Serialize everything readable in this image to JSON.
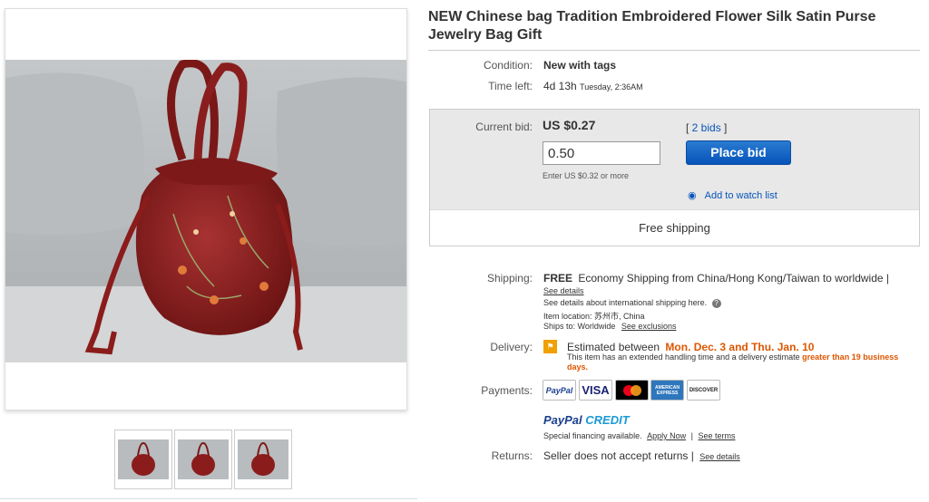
{
  "listing": {
    "title": "NEW Chinese bag Tradition Embroidered Flower Silk Satin Purse Jewelry Bag Gift"
  },
  "condition": {
    "label": "Condition:",
    "value": "New with tags"
  },
  "time_left": {
    "label": "Time left:",
    "value": "4d 13h",
    "detail": "Tuesday, 2:36AM"
  },
  "bid": {
    "label": "Current bid:",
    "price": "US $0.27",
    "bids_link": "2 bids",
    "input_value": "0.50",
    "hint": "Enter US $0.32 or more",
    "place_bid": "Place bid",
    "watch": "Add to watch list",
    "free_shipping": "Free shipping"
  },
  "shipping": {
    "label": "Shipping:",
    "free": "FREE",
    "method": "Economy Shipping from China/Hong Kong/Taiwan to worldwide |",
    "see_details": "See details",
    "intl": "See details about international shipping here.",
    "location_label": "Item location:",
    "location": "苏州市, China",
    "ships_to_label": "Ships to:",
    "ships_to": "Worldwide",
    "exclusions": "See exclusions"
  },
  "delivery": {
    "label": "Delivery:",
    "estimated": "Estimated between",
    "dates": "Mon. Dec. 3 and Thu. Jan. 10",
    "note": "This item has an extended handling time and a delivery estimate",
    "note_strong": "greater than 19 business days."
  },
  "payments": {
    "label": "Payments:",
    "logos": [
      "PayPal",
      "VISA",
      "MasterCard",
      "AMERICAN EXPRESS",
      "DISCOVER"
    ],
    "credit_brand": "PayPal",
    "credit_word": "CREDIT",
    "financing": "Special financing available.",
    "apply": "Apply Now",
    "terms": "See terms"
  },
  "returns": {
    "label": "Returns:",
    "value": "Seller does not accept returns |",
    "see_details": "See details"
  },
  "colors": {
    "accent_blue": "#0654ba",
    "delivery_orange": "#dd5600",
    "bag_red": "#8b1c1c"
  }
}
